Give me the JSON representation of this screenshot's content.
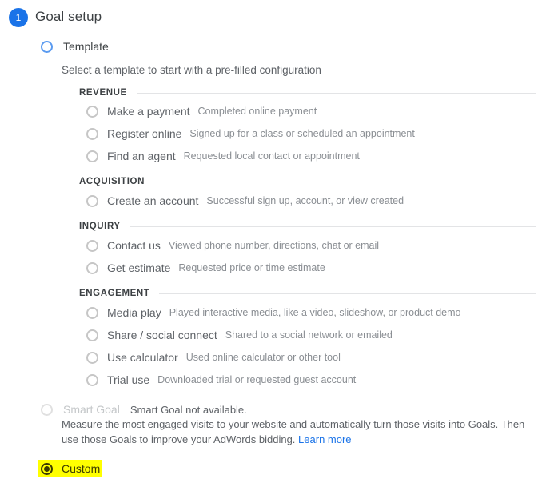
{
  "step": {
    "number": "1",
    "title": "Goal setup"
  },
  "template": {
    "label": "Template",
    "description": "Select a template to start with a pre-filled configuration"
  },
  "categories": [
    {
      "title": "REVENUE",
      "options": [
        {
          "label": "Make a payment",
          "desc": "Completed online payment"
        },
        {
          "label": "Register online",
          "desc": "Signed up for a class or scheduled an appointment"
        },
        {
          "label": "Find an agent",
          "desc": "Requested local contact or appointment"
        }
      ]
    },
    {
      "title": "ACQUISITION",
      "options": [
        {
          "label": "Create an account",
          "desc": "Successful sign up, account, or view created"
        }
      ]
    },
    {
      "title": "INQUIRY",
      "options": [
        {
          "label": "Contact us",
          "desc": "Viewed phone number, directions, chat or email"
        },
        {
          "label": "Get estimate",
          "desc": "Requested price or time estimate"
        }
      ]
    },
    {
      "title": "ENGAGEMENT",
      "options": [
        {
          "label": "Media play",
          "desc": "Played interactive media, like a video, slideshow, or product demo"
        },
        {
          "label": "Share / social connect",
          "desc": "Shared to a social network or emailed"
        },
        {
          "label": "Use calculator",
          "desc": "Used online calculator or other tool"
        },
        {
          "label": "Trial use",
          "desc": "Downloaded trial or requested guest account"
        }
      ]
    }
  ],
  "smart_goal": {
    "label": "Smart Goal",
    "note": "Smart Goal not available.",
    "paragraph": "Measure the most engaged visits to your website and automatically turn those visits into Goals. Then use those Goals to improve your AdWords bidding.",
    "link_label": "Learn more"
  },
  "custom": {
    "label": "Custom",
    "selected": true,
    "highlight_color": "#ffff00"
  },
  "colors": {
    "accent": "#1a73e8",
    "radio_blue": "#5b9bf0",
    "text_primary": "#3c4043",
    "text_secondary": "#5f6368",
    "text_muted": "#8a8e93",
    "rule": "#e3e4e6",
    "highlight": "#ffff00"
  }
}
